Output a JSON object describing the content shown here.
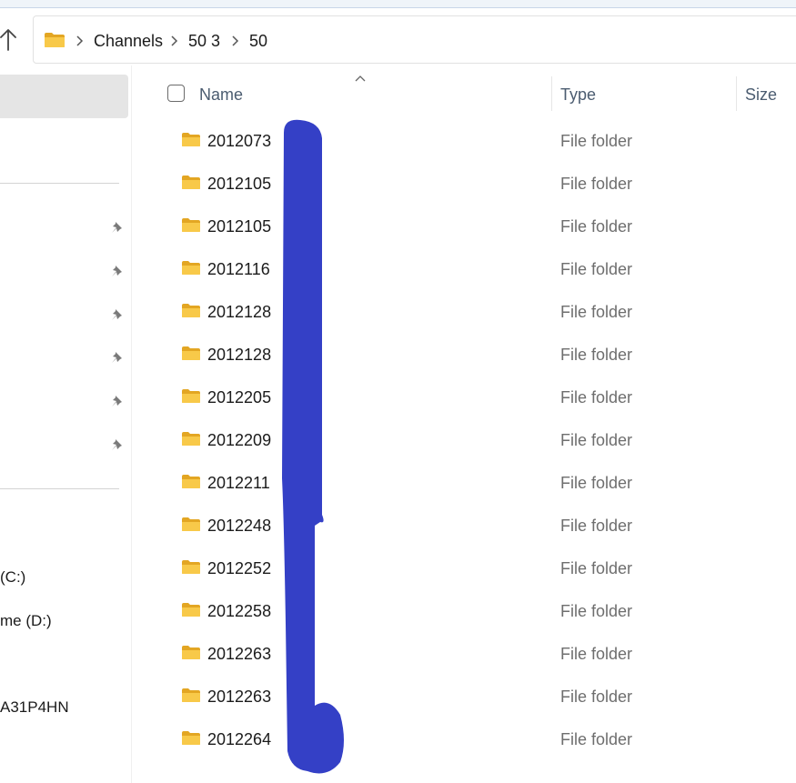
{
  "breadcrumb": {
    "items": [
      {
        "label": "Channels"
      },
      {
        "label": "50 3"
      },
      {
        "label": "50"
      }
    ]
  },
  "sidebar": {
    "pinned_count": 6,
    "drives": [
      {
        "label": "(C:)"
      },
      {
        "label": "me (D:)"
      }
    ],
    "network": {
      "label": "A31P4HN"
    }
  },
  "columns": {
    "name": "Name",
    "type": "Type",
    "size": "Size"
  },
  "files": [
    {
      "name": "2012073",
      "type": "File folder"
    },
    {
      "name": "2012105",
      "type": "File folder"
    },
    {
      "name": "2012105",
      "type": "File folder"
    },
    {
      "name": "2012116",
      "type": "File folder"
    },
    {
      "name": "2012128",
      "type": "File folder"
    },
    {
      "name": "2012128",
      "type": "File folder"
    },
    {
      "name": "2012205",
      "type": "File folder"
    },
    {
      "name": "2012209",
      "type": "File folder"
    },
    {
      "name": "2012211",
      "type": "File folder"
    },
    {
      "name": "2012248",
      "type": "File folder"
    },
    {
      "name": "2012252",
      "type": "File folder"
    },
    {
      "name": "2012258",
      "type": "File folder"
    },
    {
      "name": "2012263",
      "type": "File folder"
    },
    {
      "name": "2012263",
      "type": "File folder"
    },
    {
      "name": "2012264",
      "type": "File folder"
    }
  ],
  "colors": {
    "folder": "#f8c949",
    "folder_dark": "#e3a623",
    "redaction": "#3440c6",
    "selection": "#e5e5e5"
  },
  "icons": {
    "up": "arrow-up-icon",
    "folder": "folder-icon",
    "pin": "pin-icon",
    "breadcrumb_separator": "chevron-right-icon",
    "sort": "sort-up-icon"
  }
}
